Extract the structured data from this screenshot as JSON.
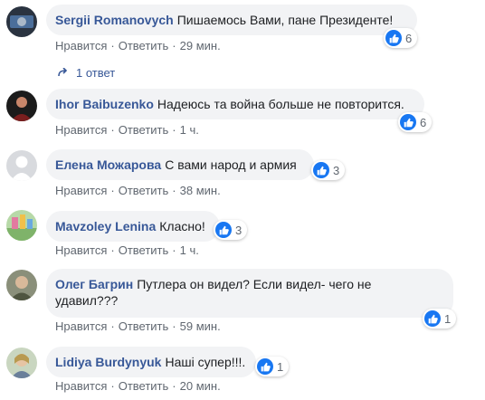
{
  "actions": {
    "like_label": "Нравится",
    "reply_label": "Ответить",
    "separator": "·"
  },
  "comments": [
    {
      "author": "Sergii Romanovych",
      "text": "Пишаемось Вами, пане Президенте!",
      "time": "29 мин.",
      "likes": "6",
      "replies": "1 ответ"
    },
    {
      "author": "Ihor Baibuzenko",
      "text": "Надеюсь та война больше не повторится.",
      "time": "1 ч.",
      "likes": "6"
    },
    {
      "author": "Елена Можарова",
      "text": "С вами народ и армия",
      "time": "38 мин.",
      "likes": "3"
    },
    {
      "author": "Mavzoley Lenina",
      "text": "Класно!",
      "time": "1 ч.",
      "likes": "3"
    },
    {
      "author": "Олег Багрин",
      "text_line1": "Путлера он видел? Если видел- чего не",
      "text_line2": "удавил???",
      "time": "59 мин.",
      "likes": "1"
    },
    {
      "author": "Lidiya Burdynyuk",
      "text": "Наші супер!!!.",
      "time": "20 мин.",
      "likes": "1"
    }
  ],
  "colors": {
    "author": "#385898",
    "bubble": "#f2f3f5",
    "like": "#1877f2",
    "meta": "#606770"
  },
  "icons": {
    "like": "thumbs-up-icon",
    "reply_arrow": "reply-arrow-icon"
  }
}
